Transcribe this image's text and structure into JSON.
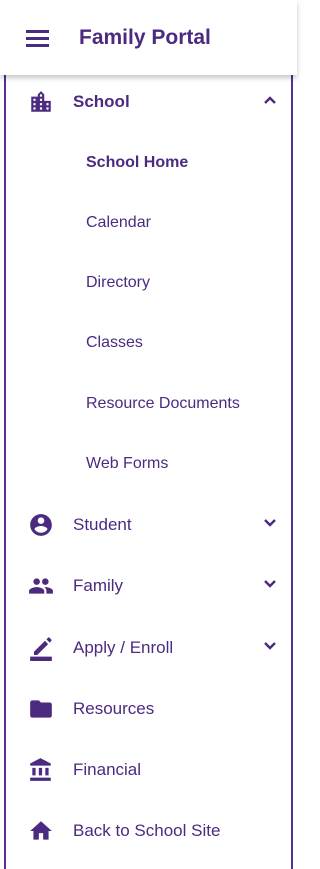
{
  "header": {
    "title": "Family Portal",
    "menu_icon": "hamburger-menu-icon"
  },
  "colors": {
    "brand": "#4b2a80",
    "border": "#5c2d91",
    "background": "#ffffff"
  },
  "nav": {
    "school": {
      "label": "School",
      "icon": "school-building-icon",
      "expanded": true,
      "subitems": [
        {
          "label": "School Home",
          "active": true
        },
        {
          "label": "Calendar"
        },
        {
          "label": "Directory"
        },
        {
          "label": "Classes"
        },
        {
          "label": "Resource Documents"
        },
        {
          "label": "Web Forms"
        }
      ]
    },
    "student": {
      "label": "Student",
      "icon": "account-circle-icon",
      "expandable": true
    },
    "family": {
      "label": "Family",
      "icon": "people-icon",
      "expandable": true
    },
    "apply": {
      "label": "Apply / Enroll",
      "icon": "pencil-icon",
      "expandable": true
    },
    "resources": {
      "label": "Resources",
      "icon": "folder-icon"
    },
    "financial": {
      "label": "Financial",
      "icon": "bank-icon"
    },
    "back": {
      "label": "Back to School Site",
      "icon": "home-icon"
    }
  }
}
